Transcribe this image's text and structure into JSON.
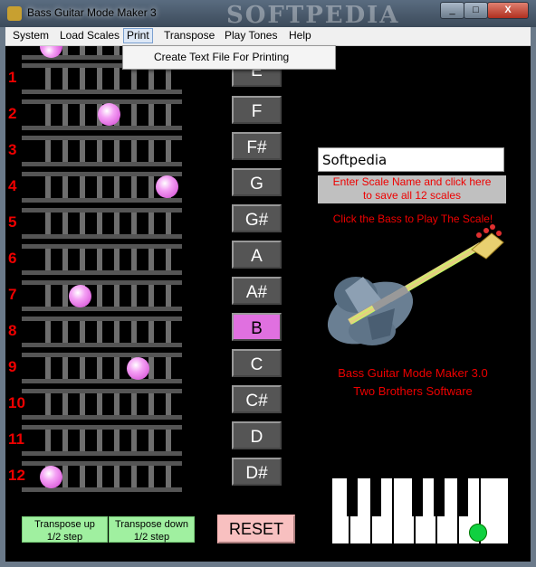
{
  "window": {
    "title": "Bass Guitar Mode Maker 3",
    "watermark": "SOFTPEDIA",
    "min": "_",
    "max": "□",
    "close": "X"
  },
  "menu": {
    "system": "System",
    "load_scales": "Load Scales",
    "print": "Print",
    "transpose": "Transpose",
    "play_tones": "Play Tones",
    "help": "Help"
  },
  "dropdown": {
    "item": "Create Text File For Printing"
  },
  "frets": {
    "f1": "1",
    "f2": "2",
    "f3": "3",
    "f4": "4",
    "f5": "5",
    "f6": "6",
    "f7": "7",
    "f8": "8",
    "f9": "9",
    "f10": "10",
    "f11": "11",
    "f12": "12"
  },
  "notes": {
    "e": "E",
    "f": "F",
    "fs": "F#",
    "g": "G",
    "gs": "G#",
    "a": "A",
    "as": "A#",
    "b": "B",
    "c": "C",
    "cs": "C#",
    "d": "D",
    "ds": "D#"
  },
  "selected_note": "B",
  "scale": {
    "name_value": "Softpedia",
    "help_line1": "Enter Scale Name and click here",
    "help_line2": "to save all 12 scales"
  },
  "bass_hint": "Click the Bass to Play The Scale!",
  "about": {
    "line1": "Bass Guitar Mode Maker 3.0",
    "line2": "Two Brothers Software"
  },
  "buttons": {
    "transpose_up_1": "Transpose up",
    "transpose_up_2": "1/2 step",
    "transpose_down_1": "Transpose down",
    "transpose_down_2": "1/2 step",
    "reset": "RESET"
  },
  "colors": {
    "fret_number": "#ee0000",
    "selected_note": "#e070e0",
    "dot": "#e070e0",
    "green_marker": "#10d040"
  }
}
